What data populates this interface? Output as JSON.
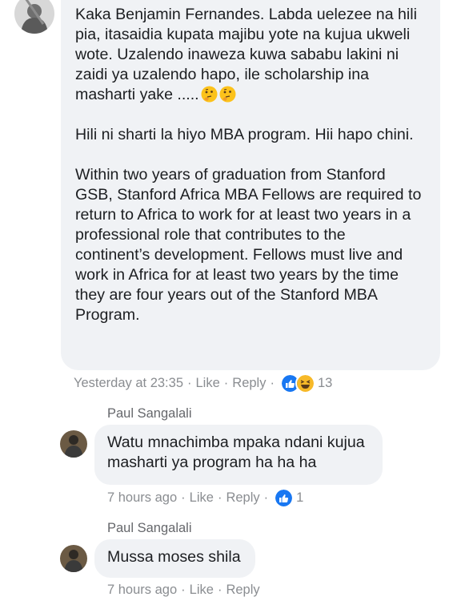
{
  "comment": {
    "paragraphs": [
      "Kaka Benjamin Fernandes. Labda uelezee na hili\npia, itasaidia kupata majibu yote na kujua ukweli\nwote. Uzalendo inaweza kuwa sababu lakini ni\nzaidi ya uzalendo hapo, ile scholarship ina\nmasharti yake .....",
      "Hili ni sharti la hiyo MBA program. Hii hapo chini.",
      "Within two years of graduation from Stanford\nGSB, Stanford Africa MBA Fellows are required to\nreturn to Africa to work for at least two years in a\nprofessional role that contributes to the\ncontinent’s development. Fellows must live and\nwork in Africa for at least two years by the time\nthey are four years out of the Stanford MBA\nProgram."
    ],
    "emoji": [
      "thinking-face-icon",
      "thinking-face-icon"
    ],
    "timestamp": "Yesterday at 23:35",
    "like_label": "Like",
    "reply_label": "Reply",
    "reaction_icons": [
      "like-reaction-icon",
      "haha-reaction-icon"
    ],
    "reaction_count": "13"
  },
  "replies": [
    {
      "author": "Paul Sangalali",
      "lines": "Watu mnachimba mpaka ndani kujua\nmasharti ya  program ha ha ha",
      "timestamp": "7 hours ago",
      "like_label": "Like",
      "reply_label": "Reply",
      "reaction_count": "1"
    },
    {
      "author": "Paul Sangalali",
      "lines": "Mussa moses shila",
      "timestamp": "7 hours ago",
      "like_label": "Like",
      "reply_label": "Reply"
    }
  ],
  "colors": {
    "bubble": "#f0f2f5",
    "meta_text": "#8a8d91",
    "like_blue": "#1877f2",
    "haha_yellow": "#f7b928"
  }
}
